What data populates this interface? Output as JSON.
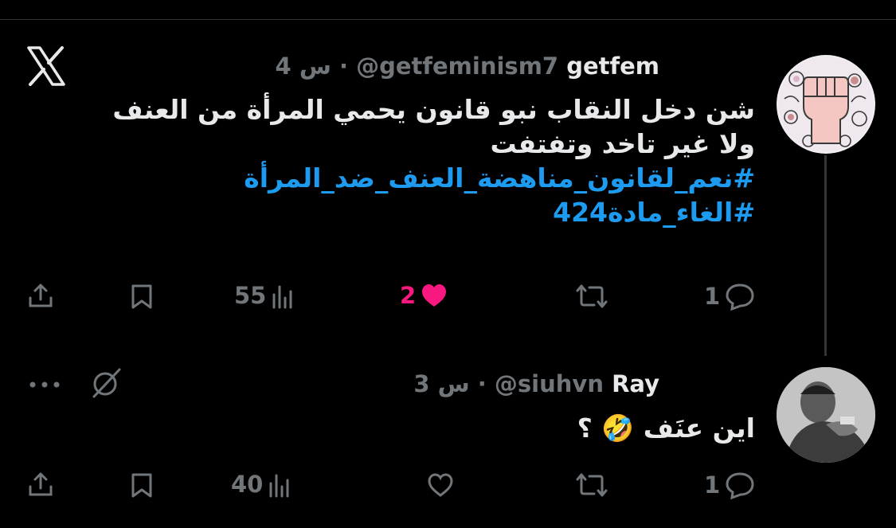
{
  "brand": {
    "icon": "x-logo-icon"
  },
  "tweet1": {
    "name": "getfem",
    "handle": "@getfeminism7",
    "separator": "·",
    "time": "4 س",
    "lines": [
      "شن دخل النقاب نبو قانون يحمي المرأة من العنف",
      "ولا غير تاخد وتفتفت"
    ],
    "hashtags": [
      "#نعم_لقانون_مناهضة_العنف_ضد_المرأة",
      "#الغاء_مادة424"
    ],
    "actions": {
      "replies": "1",
      "likes": "2",
      "views": "55"
    },
    "avatar_icon": "raised-fist-floral-avatar"
  },
  "tweet2": {
    "name": "Ray",
    "handle": "@siuhvn",
    "separator": "·",
    "time": "3 س",
    "text": "اين عنَف 🤣 ؟",
    "actions": {
      "replies": "1",
      "views": "40"
    },
    "avatar_icon": "person-photo-avatar"
  },
  "colors": {
    "accent": "#1d9bf0",
    "like": "#f91880",
    "muted": "#71767b",
    "text": "#e7e9ea"
  }
}
